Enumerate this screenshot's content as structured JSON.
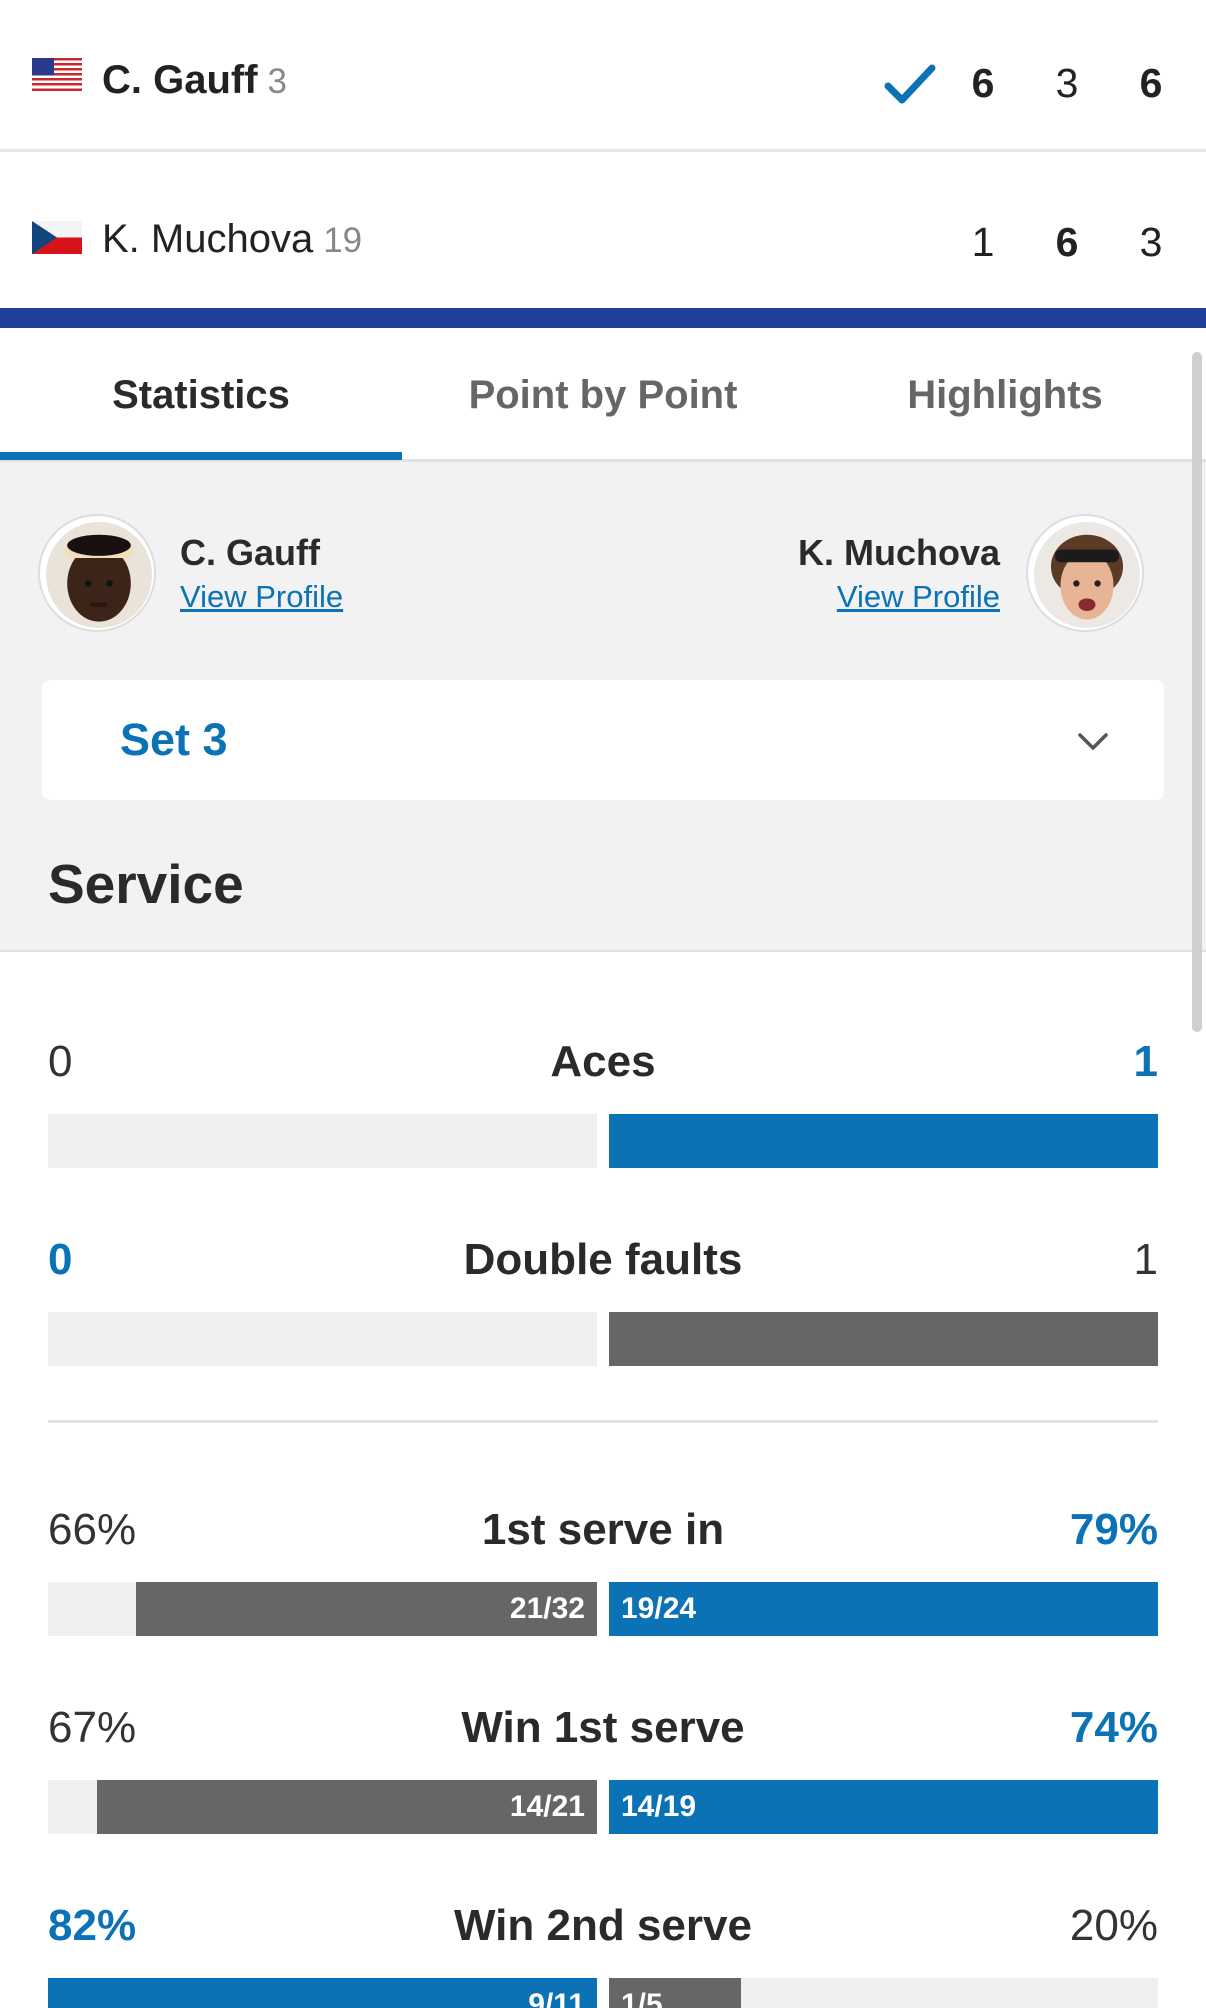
{
  "match": {
    "player1": {
      "name": "C. Gauff",
      "seed": "3",
      "winner": true,
      "sets": [
        "6",
        "3",
        "6"
      ],
      "set_won": [
        true,
        false,
        true
      ]
    },
    "player2": {
      "name": "K. Muchova",
      "seed": "19",
      "winner": false,
      "sets": [
        "1",
        "6",
        "3"
      ],
      "set_won": [
        false,
        true,
        false
      ]
    }
  },
  "tabs": [
    "Statistics",
    "Point by Point",
    "Highlights"
  ],
  "active_tab": "Statistics",
  "players": {
    "left": {
      "name": "C. Gauff",
      "link": "View Profile"
    },
    "right": {
      "name": "K. Muchova",
      "link": "View Profile"
    }
  },
  "set_selector": {
    "value": "Set 3"
  },
  "section": {
    "title": "Service"
  },
  "colors": {
    "accent": "#0b72b5",
    "header_rule": "#1f3f98",
    "bar_grey": "#666666",
    "bar_bg": "#efefef"
  },
  "stats": [
    {
      "label": "Aces",
      "left_value": "0",
      "right_value": "1",
      "left_fill": 0,
      "right_fill": 1,
      "left_color": "grey",
      "right_color": "blue",
      "left_ratio": "",
      "right_ratio": "",
      "highlight": "right"
    },
    {
      "label": "Double faults",
      "left_value": "0",
      "right_value": "1",
      "left_fill": 0,
      "right_fill": 1,
      "left_color": "grey",
      "right_color": "grey",
      "left_ratio": "",
      "right_ratio": "",
      "highlight": "left"
    },
    {
      "label": "1st serve in",
      "left_value": "66%",
      "right_value": "79%",
      "left_fill": 0.84,
      "right_fill": 1,
      "left_color": "grey",
      "right_color": "blue",
      "left_ratio": "21/32",
      "right_ratio": "19/24",
      "highlight": "right"
    },
    {
      "label": "Win 1st serve",
      "left_value": "67%",
      "right_value": "74%",
      "left_fill": 0.91,
      "right_fill": 1,
      "left_color": "grey",
      "right_color": "blue",
      "left_ratio": "14/21",
      "right_ratio": "14/19",
      "highlight": "right"
    },
    {
      "label": "Win 2nd serve",
      "left_value": "82%",
      "right_value": "20%",
      "left_fill": 1,
      "right_fill": 0.24,
      "left_color": "blue",
      "right_color": "grey",
      "left_ratio": "9/11",
      "right_ratio": "1/5",
      "highlight": "left"
    }
  ]
}
